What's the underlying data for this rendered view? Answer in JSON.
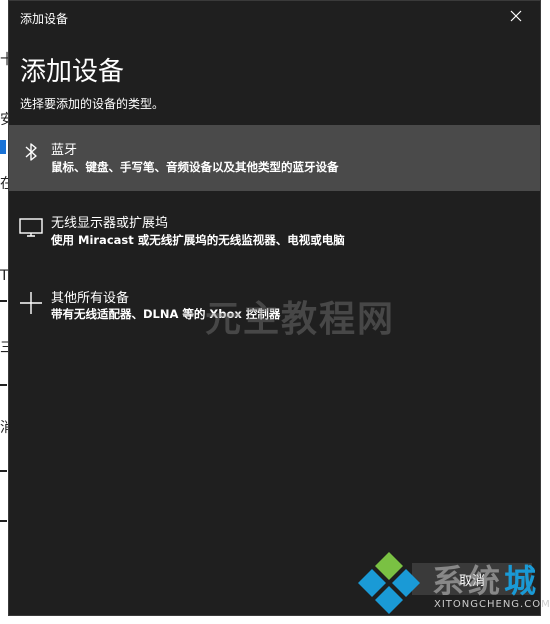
{
  "background_fragments": [
    "十",
    "安",
    "在",
    "T",
    "三",
    "消"
  ],
  "dialog": {
    "title": "添加设备",
    "heading": "添加设备",
    "subheading": "选择要添加的设备的类型。",
    "options": [
      {
        "icon": "bluetooth-icon",
        "label": "蓝牙",
        "description": "鼠标、键盘、手写笔、音频设备以及其他类型的蓝牙设备",
        "selected": true
      },
      {
        "icon": "monitor-icon",
        "label": "无线显示器或扩展坞",
        "description": "使用 Miracast 或无线扩展坞的无线监视器、电视或电脑",
        "selected": false
      },
      {
        "icon": "plus-icon",
        "label": "其他所有设备",
        "description": "带有无线适配器、DLNA 等的 Xbox 控制器",
        "selected": false
      }
    ],
    "cancel_label": "取消"
  },
  "watermark": {
    "center_text": "元主教程网",
    "site_text_gray": "系统",
    "site_text_accent": "城",
    "site_url": "XITONGCHENG.COM",
    "accent_color": "#1a9ad6"
  }
}
